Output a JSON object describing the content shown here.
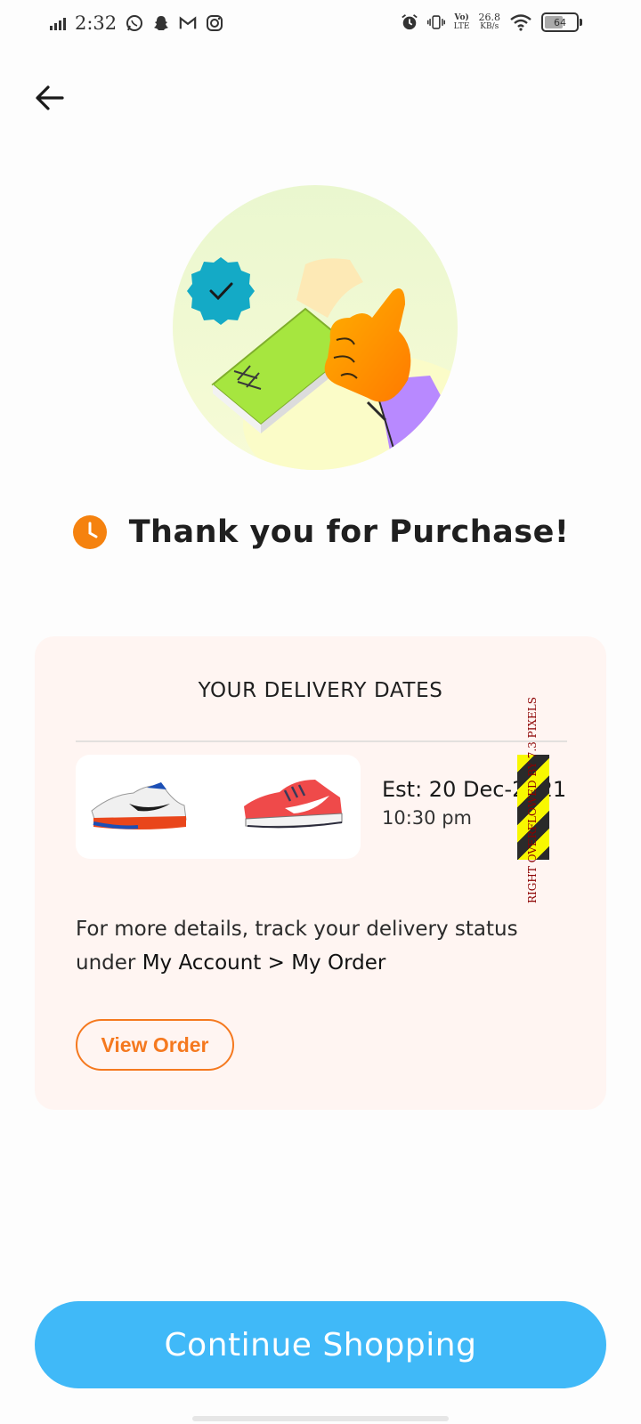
{
  "status_bar": {
    "time": "2:32",
    "network_speed_value": "26.8",
    "network_speed_unit": "KB/s",
    "volte_top": "Vo)",
    "volte_bottom": "LTE",
    "battery": "64",
    "icons": [
      "signal-icon",
      "whatsapp-icon",
      "snapchat-icon",
      "gmail-icon",
      "instagram-icon",
      "alarm-icon",
      "vibrate-icon",
      "volte-icon",
      "wifi-icon",
      "battery-icon"
    ]
  },
  "header": {
    "back_icon": "arrow-left-icon"
  },
  "confirmation": {
    "title": "Thank you for Purchase!",
    "badge_icon": "clock-icon",
    "illustration": "hand-holding-card-illustration"
  },
  "delivery": {
    "heading": "YOUR DELIVERY DATES",
    "products": [
      {
        "name": "white-orange-running-shoe"
      },
      {
        "name": "red-running-shoe"
      }
    ],
    "est_date": "Est: 20 Dec-2021",
    "est_time": "10:30 pm",
    "overflow_warning": "RIGHT OVERFLOWED BY 7.3 PIXELS",
    "info_text": "For more details, track your delivery status under",
    "info_path": "My Account > My Order",
    "view_order_label": "View Order"
  },
  "footer": {
    "continue_label": "Continue Shopping"
  },
  "colors": {
    "accent_orange": "#f5791f",
    "primary_blue": "#40b9f8",
    "card_bg": "#fff5f2"
  }
}
